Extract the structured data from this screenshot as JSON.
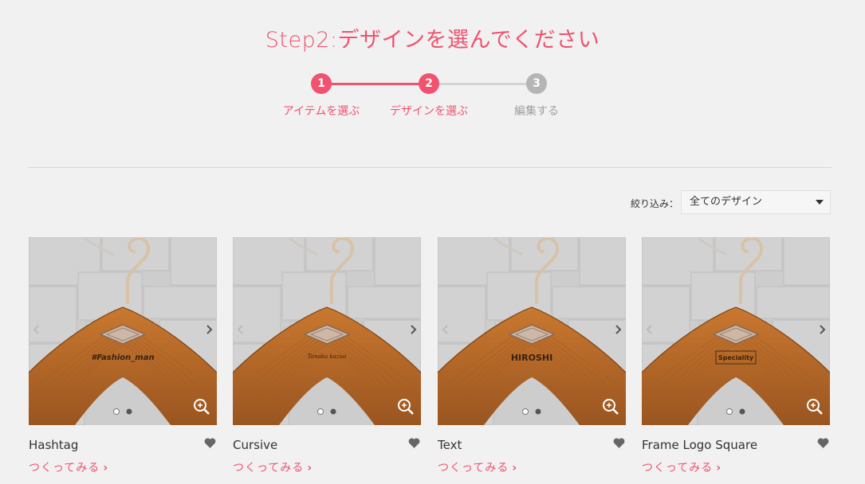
{
  "page_title": "Step2:デザインを選んでください",
  "stepper": {
    "steps": [
      {
        "number": "1",
        "label": "アイテムを選ぶ"
      },
      {
        "number": "2",
        "label": "デザインを選ぶ"
      },
      {
        "number": "3",
        "label": "編集する"
      }
    ]
  },
  "filter": {
    "label": "絞り込み：",
    "selected": "全てのデザイン"
  },
  "cards": [
    {
      "name": "Hashtag",
      "engraving": "#Fashion_man",
      "cta": "つくってみる"
    },
    {
      "name": "Cursive",
      "engraving": "Tanaka kazuo",
      "cta": "つくってみる"
    },
    {
      "name": "Text",
      "engraving": "HIROSHI",
      "cta": "つくってみる"
    },
    {
      "name": "Frame Logo Square",
      "engraving": "Speciality",
      "cta": "つくってみる"
    }
  ],
  "colors": {
    "accent": "#f0526f",
    "inactive": "#b5b5b5",
    "wood": "#b8692a",
    "tile": "#c9c9c9"
  }
}
